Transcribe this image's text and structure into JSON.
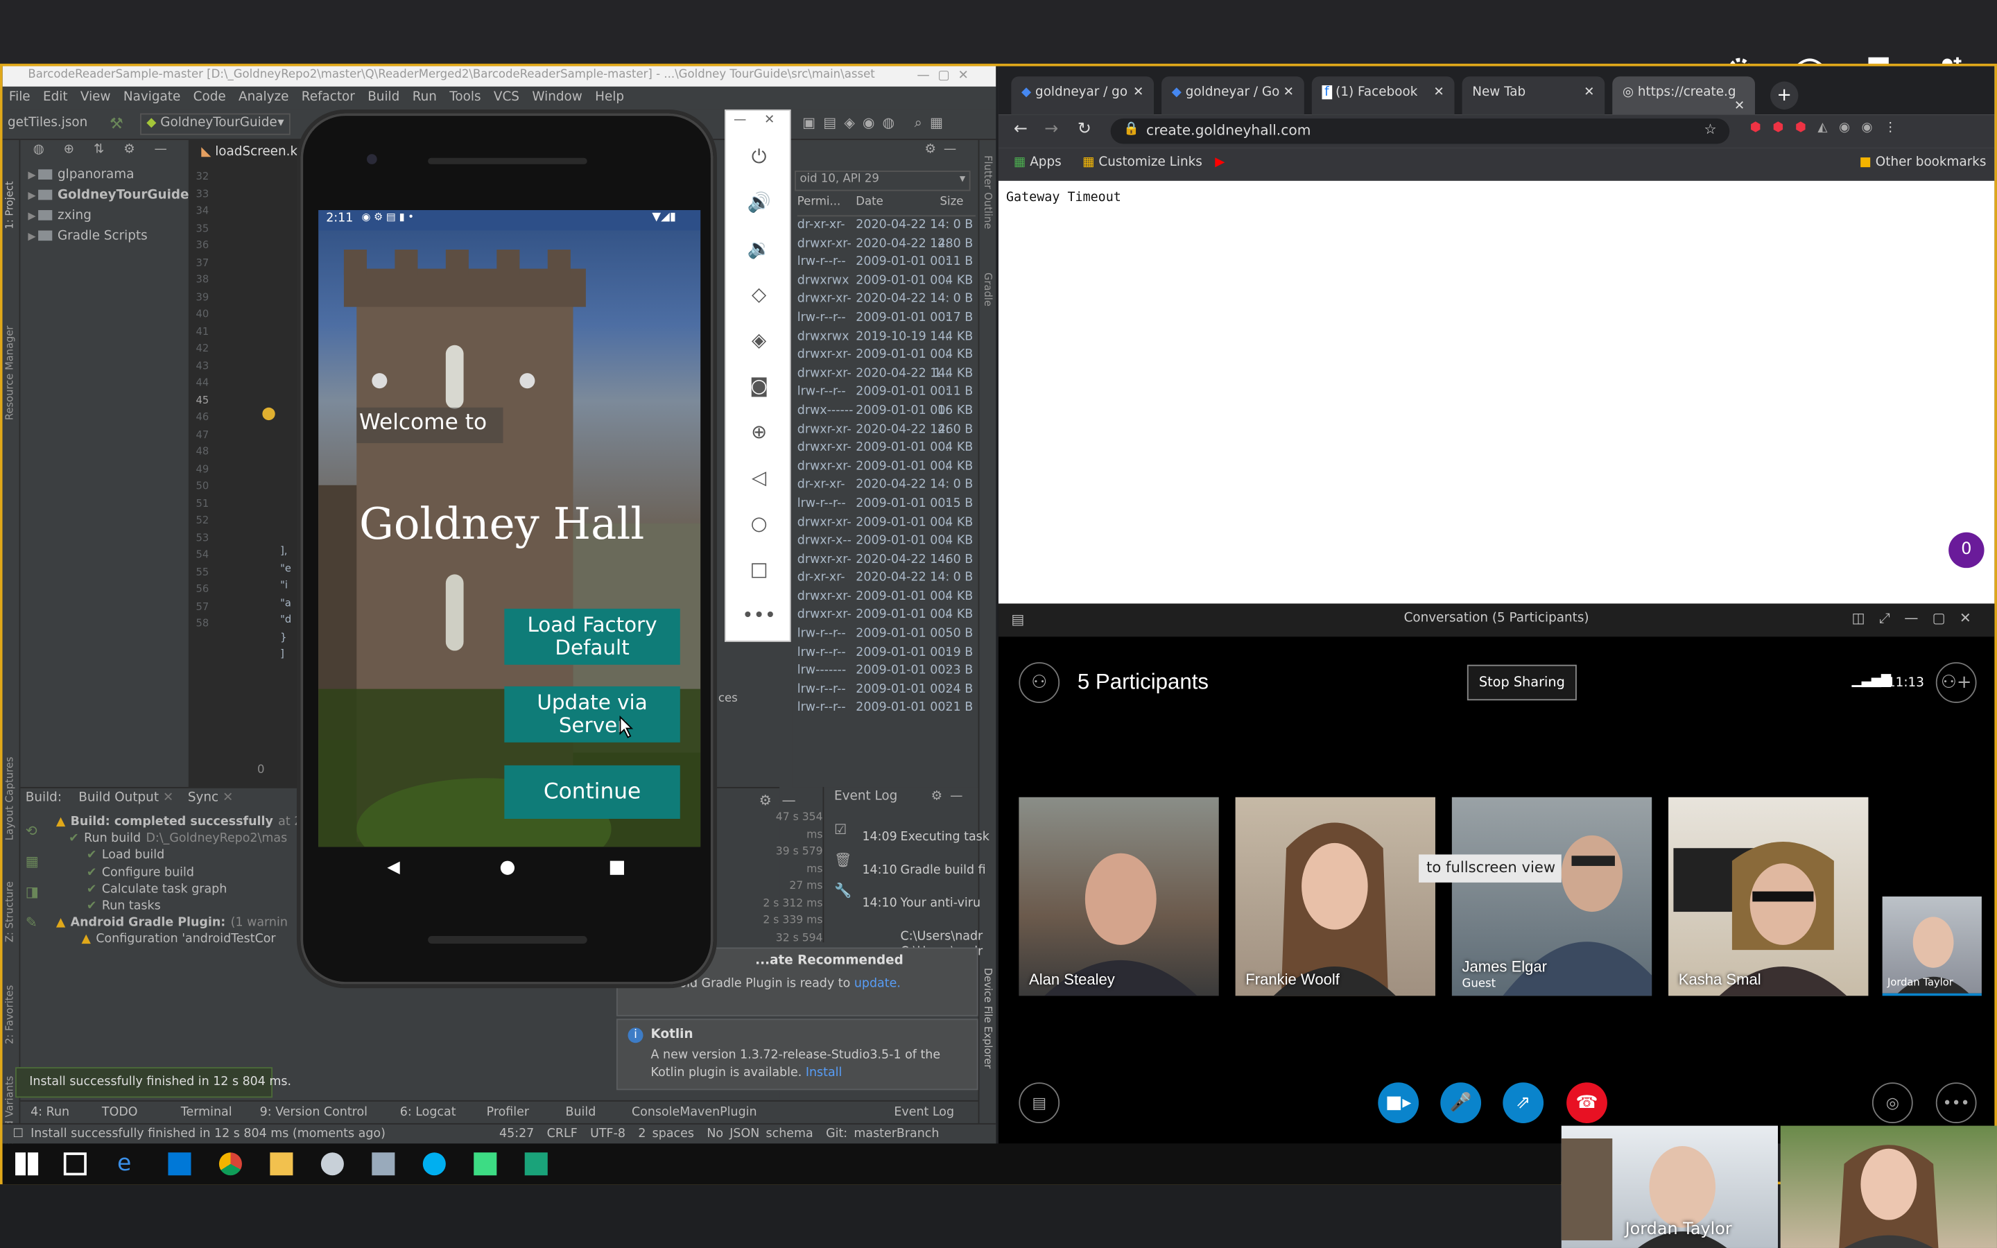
{
  "android_studio": {
    "title": "BarcodeReaderSample-master [D:\\_GoldneyRepo2\\master\\Q\\ReaderMerged2\\BarcodeReaderSample-master] - ...\\Goldney TourGuide\\src\\main\\asset",
    "menu": [
      "File",
      "Edit",
      "View",
      "Navigate",
      "Code",
      "Analyze",
      "Refactor",
      "Build",
      "Run",
      "Tools",
      "VCS",
      "Window",
      "Help"
    ],
    "file_tab": "getTiles.json",
    "run_config": "GoldneyTourGuide",
    "editor_tab": "loadScreen.kt",
    "project_tree": [
      {
        "label": "glpanorama"
      },
      {
        "label": "GoldneyTourGuide"
      },
      {
        "label": "zxing"
      },
      {
        "label": "Gradle Scripts"
      }
    ],
    "line_numbers": [
      "32",
      "33",
      "34",
      "35",
      "36",
      "37",
      "38",
      "39",
      "40",
      "41",
      "42",
      "43",
      "44",
      "45",
      "46",
      "47",
      "48",
      "49",
      "50",
      "51",
      "52",
      "53",
      "54",
      "55",
      "56",
      "57",
      "58"
    ],
    "device_label": "oid 10, API 29",
    "explorer_headers": [
      "Permi...",
      "Date",
      "Size"
    ],
    "explorer_rows": [
      [
        "dr-xr-xr-",
        "2020-04-22 14:",
        "0 B"
      ],
      [
        "drwxr-xr-",
        "2020-04-22 14:",
        "280 B"
      ],
      [
        "lrw-r--r--",
        "2009-01-01 00:",
        "11 B"
      ],
      [
        "drwxrwx",
        "2009-01-01 00:",
        "4 KB"
      ],
      [
        "drwxr-xr-",
        "2020-04-22 14:",
        "0 B"
      ],
      [
        "lrw-r--r--",
        "2009-01-01 00:",
        "17 B"
      ],
      [
        "drwxrwx",
        "2019-10-19 14:",
        "4 KB"
      ],
      [
        "drwxr-xr-",
        "2009-01-01 00:",
        "4 KB"
      ],
      [
        "drwxr-xr-",
        "2020-04-22 14:",
        "1.4 KB"
      ],
      [
        "lrw-r--r--",
        "2009-01-01 00:",
        "11 B"
      ],
      [
        "drwx------",
        "2009-01-01 00:",
        "16 KB"
      ],
      [
        "drwxr-xr-",
        "2020-04-22 14:",
        "260 B"
      ],
      [
        "drwxr-xr-",
        "2009-01-01 00:",
        "4 KB"
      ],
      [
        "drwxr-xr-",
        "2009-01-01 00:",
        "4 KB"
      ],
      [
        "dr-xr-xr-",
        "2020-04-22 14:",
        "0 B"
      ],
      [
        "lrw-r--r--",
        "2009-01-01 00:",
        "15 B"
      ],
      [
        "drwxr-xr-",
        "2009-01-01 00:",
        "4 KB"
      ],
      [
        "drwxr-x--",
        "2009-01-01 00:",
        "4 KB"
      ],
      [
        "drwxr-xr-",
        "2020-04-22 14:",
        "60 B"
      ],
      [
        "dr-xr-xr-",
        "2020-04-22 14:",
        "0 B"
      ],
      [
        "drwxr-xr-",
        "2009-01-01 00:",
        "4 KB"
      ],
      [
        "drwxr-xr-",
        "2009-01-01 00:",
        "4 KB"
      ],
      [
        "lrw-r--r--",
        "2009-01-01 00:",
        "50 B"
      ],
      [
        "lrw-r--r--",
        "2009-01-01 00:",
        "19 B"
      ],
      [
        "lrw-------",
        "2009-01-01 00:",
        "23 B"
      ],
      [
        "lrw-r--r--",
        "2009-01-01 00:",
        "24 B"
      ],
      [
        "lrw-r--r--",
        "2009-01-01 00:",
        "21 B"
      ]
    ],
    "build_tabs": [
      "Build:",
      "Build Output",
      "Sync"
    ],
    "build_tree": [
      {
        "label": "Build: completed successfully",
        "suffix": "at 22/0"
      },
      {
        "label": "Run build",
        "suffix": "D:\\_GoldneyRepo2\\mas"
      },
      {
        "label": "Load build",
        "suffix": ""
      },
      {
        "label": "Configure build",
        "suffix": ""
      },
      {
        "label": "Calculate task graph",
        "suffix": ""
      },
      {
        "label": "Run tasks",
        "suffix": ""
      },
      {
        "label": "Android Gradle Plugin:",
        "suffix": "(1 warnin"
      },
      {
        "label": "Configuration 'androidTestCor",
        "suffix": ""
      }
    ],
    "build_times": [
      "47 s 354 ms",
      "39 s 579 ms",
      "27 ms",
      "2 s 312 ms",
      "2 s 339 ms",
      "32 s 594 ms"
    ],
    "event_log": {
      "title": "Event Log",
      "entries": [
        {
          "time": "14:09",
          "text": "Executing task"
        },
        {
          "time": "14:10",
          "text": "Gradle build fi"
        },
        {
          "time": "14:10",
          "text": "Your anti-viru"
        },
        {
          "time": "",
          "text": "C:\\Users\\nadr"
        },
        {
          "time": "",
          "text": "C:\\Users\\nadr"
        }
      ]
    },
    "notif_update": {
      "title": "...ate Recommended",
      "body": "Android Gradle Plugin is ready to",
      "link": "update."
    },
    "notif_kotlin": {
      "title": "Kotlin",
      "body": "A new version 1.3.72-release-Studio3.5-1 of the",
      "body2": "Kotlin plugin is available.",
      "link": "Install"
    },
    "toast": "Install successfully finished in 12 s 804 ms.",
    "bottom_tabs": [
      "4: Run",
      "TODO",
      "Terminal",
      "9: Version Control",
      "6: Logcat",
      "Profiler",
      "Build",
      "ConsoleMavenPlugin",
      "Event Log"
    ],
    "status_left": "Install successfully finished in 12 s 804 ms (moments ago)",
    "status_right": [
      "45:27",
      "CRLF",
      "UTF-8",
      "2 spaces",
      "No JSON schema",
      "Git: masterBranch"
    ],
    "side_tabs": [
      "1: Project",
      "Resource Manager",
      "Layout Captures",
      "Z: Structure",
      "2: Favorites",
      "Build Variants"
    ],
    "right_tabs": [
      "Flutter Outline",
      "Gradle",
      "Device File Explorer"
    ],
    "code_tail": [
      "],",
      "\"e",
      "\"i",
      "\"a",
      "\"d",
      "}",
      "]"
    ],
    "gutter_zero": "0",
    "ces": "ces"
  },
  "phone": {
    "time": "2:11",
    "welcome": "Welcome to",
    "title": "Goldney Hall",
    "buttons": [
      "Load Factory Default",
      "Update via Server",
      "Continue"
    ]
  },
  "emulator_controls": [
    "close",
    "minimize",
    "power",
    "volume-up",
    "volume-down",
    "rotate-left",
    "rotate-right",
    "screenshot",
    "zoom",
    "back",
    "home",
    "overview",
    "more"
  ],
  "chrome": {
    "tabs": [
      {
        "label": "goldneyar / go"
      },
      {
        "label": "goldneyar / Go"
      },
      {
        "label": "(1) Facebook"
      },
      {
        "label": "New Tab"
      },
      {
        "label": "https://create.g"
      }
    ],
    "url": "create.goldneyhall.com",
    "bookmarks": [
      "Apps",
      "Customize Links"
    ],
    "other_bookmarks": "Other bookmarks",
    "page_text": "Gateway Timeout",
    "badge": "0"
  },
  "skype": {
    "title": "Conversation (5 Participants)",
    "participants_label": "5 Participants",
    "stop_sharing": "Stop Sharing",
    "time": "11:13",
    "tooltip": "to fullscreen view",
    "tiles": [
      {
        "name": "Alan Stealey",
        "sub": ""
      },
      {
        "name": "Frankie Woolf",
        "sub": ""
      },
      {
        "name": "James Elgar",
        "sub": "Guest"
      },
      {
        "name": "Kasha Smal",
        "sub": ""
      },
      {
        "name": "Jordan Taylor",
        "sub": ""
      }
    ],
    "self_preview_name": "Jordan Taylor"
  },
  "colors": {
    "accent": "#e0a81a",
    "teal": "#0f7c78",
    "skype_blue": "#0a84cc",
    "end_call": "#e81123",
    "badge": "#6a1b9a"
  }
}
